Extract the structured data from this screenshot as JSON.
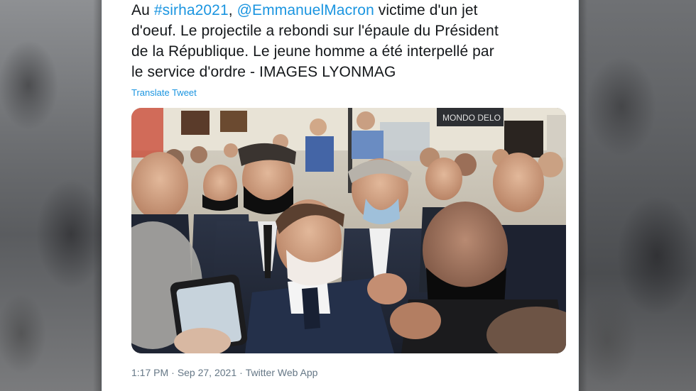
{
  "tweet": {
    "text": {
      "l1_prefix": "Au ",
      "l1_hashtag": "#sirha2021",
      "l1_comma": ", ",
      "l1_mention": "@EmmanuelMacron",
      "l1_rest": " victime d'un jet",
      "l2": "d'oeuf. Le projectile a rebondi sur l'épaule du Président",
      "l3": "de la République. Le jeune homme a été interpellé par",
      "l4": "le service d'ordre - IMAGES LYONMAG"
    },
    "translate_label": "Translate Tweet",
    "media": {
      "sign_text": "MONDO DELO"
    },
    "meta": {
      "time": "1:17 PM",
      "separator": "·",
      "date": "Sep 27, 2021",
      "source": "Twitter Web App"
    }
  },
  "colors": {
    "link": "#1b95e0",
    "text": "#14171a",
    "meta": "#657786"
  }
}
